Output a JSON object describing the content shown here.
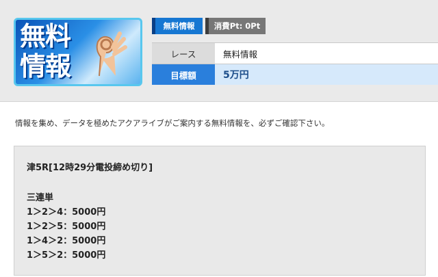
{
  "thumbnail": {
    "line1": "無料",
    "line2": "情報",
    "icon": "ok-hand-icon"
  },
  "tags": {
    "free": "無料情報",
    "cost": "消費Pt: 0Pt"
  },
  "info": {
    "race_label": "レース",
    "race_value": "無料情報",
    "goal_label": "目標額",
    "goal_value": "5万円"
  },
  "intro": "情報を集め、データを極めたアクアライブがご案内する無料情報を、必ずご確認下さい。",
  "picks": {
    "race": "津5R[12時29分電投締め切り]",
    "type": "三連単",
    "bets": [
      "1＞2＞4：5000円",
      "1＞2＞5：5000円",
      "1＞4＞2：5000円",
      "1＞5＞2：5000円"
    ]
  },
  "colors": {
    "accent": "#2a7fdc",
    "goal_bg": "#d6e9fb",
    "tag_gray": "#777777"
  }
}
